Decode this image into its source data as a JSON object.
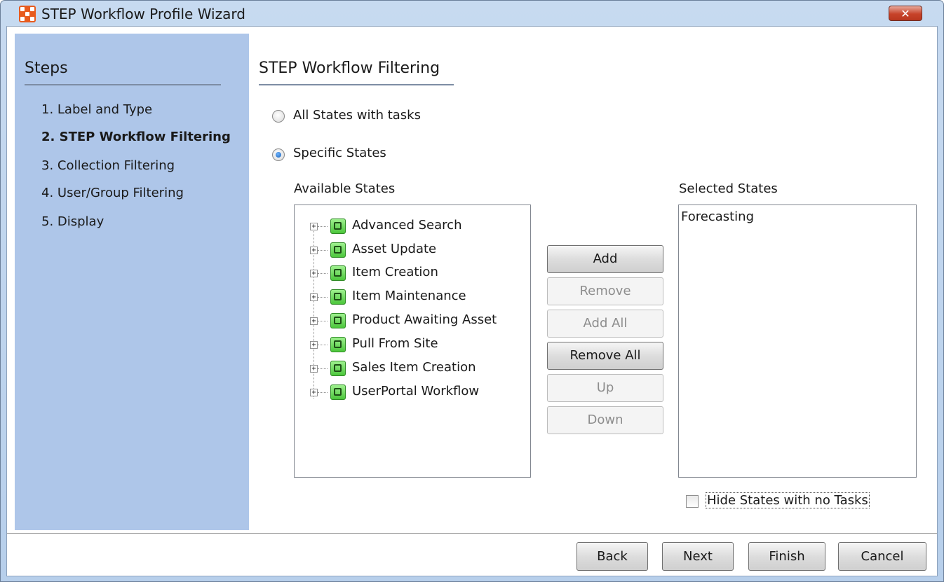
{
  "window": {
    "title": "STEP Workflow Profile Wizard",
    "close_glyph": "✕",
    "close_icon": "close-icon"
  },
  "sidebar": {
    "heading": "Steps",
    "items": [
      {
        "label": "1. Label and Type",
        "current": false
      },
      {
        "label": "2. STEP Workflow Filtering",
        "current": true
      },
      {
        "label": "3. Collection Filtering",
        "current": false
      },
      {
        "label": "4. User/Group Filtering",
        "current": false
      },
      {
        "label": "5. Display",
        "current": false
      }
    ]
  },
  "main": {
    "title": "STEP Workflow Filtering",
    "options": [
      {
        "label": "All States with tasks",
        "selected": false
      },
      {
        "label": "Specific States",
        "selected": true
      }
    ],
    "available_label": "Available States",
    "selected_label": "Selected States",
    "available_states": [
      "Advanced Search",
      "Asset Update",
      "Item Creation",
      "Item Maintenance",
      "Product Awaiting Asset",
      "Pull From Site",
      "Sales Item Creation",
      "UserPortal Workflow"
    ],
    "tree_expander_glyph": "+",
    "selected_states": [
      "Forecasting"
    ],
    "buttons": [
      {
        "label": "Add",
        "enabled": true
      },
      {
        "label": "Remove",
        "enabled": false
      },
      {
        "label": "Add All",
        "enabled": false
      },
      {
        "label": "Remove All",
        "enabled": true
      },
      {
        "label": "Up",
        "enabled": false
      },
      {
        "label": "Down",
        "enabled": false
      }
    ],
    "hide_empty_label": "Hide States with no Tasks",
    "hide_empty_checked": false
  },
  "footer": {
    "buttons": [
      {
        "label": "Back"
      },
      {
        "label": "Next"
      },
      {
        "label": "Finish"
      },
      {
        "label": "Cancel"
      }
    ]
  },
  "colors": {
    "sidebar_bg": "#aec6e9",
    "window_frame": "#b7cfeb",
    "close_button": "#c7432a",
    "workflow_icon": "#4cc63b"
  }
}
